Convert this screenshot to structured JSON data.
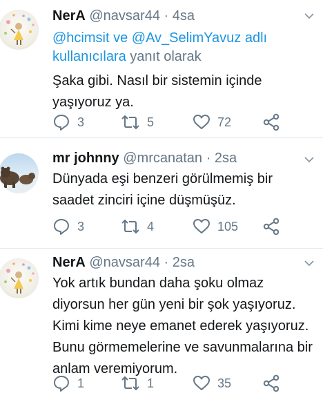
{
  "tweets": [
    {
      "name": "NerA",
      "handle": "@navsar44",
      "dot": "·",
      "time": "4sa",
      "reply_link": "@hcimsit ve @Av_SelimYavuz adlı kullanıcılara",
      "reply_suffix": " yanıt olarak",
      "text": "Şaka gibi. Nasıl bir sistemin içinde yaşıyoruz ya.",
      "replies": "3",
      "retweets": "5",
      "likes": "72"
    },
    {
      "name": "mr johnny",
      "handle": "@mrcanatan",
      "dot": "·",
      "time": "2sa",
      "text": "Dünyada eşi benzeri görülmemiş bir saadet zinciri içine düşmüşüz.",
      "replies": "3",
      "retweets": "4",
      "likes": "105"
    },
    {
      "name": "NerA",
      "handle": "@navsar44",
      "dot": "·",
      "time": "2sa",
      "text": "Yok artık bundan daha şoku olmaz diyorsun her gün yeni bir şok yaşıyoruz. Kimi kime neye emanet ederek yaşıyoruz. Bunu görmemelerine ve savunmalarına bir anlam veremiyorum.",
      "replies": "1",
      "retweets": "1",
      "likes": "35"
    }
  ],
  "colors": {
    "text": "#14171a",
    "secondary": "#657786",
    "link": "#1b95e0",
    "divider": "#e1e8ed"
  },
  "icons": [
    "reply-icon",
    "retweet-icon",
    "like-icon",
    "share-icon",
    "caret-down-icon",
    "avatar"
  ]
}
